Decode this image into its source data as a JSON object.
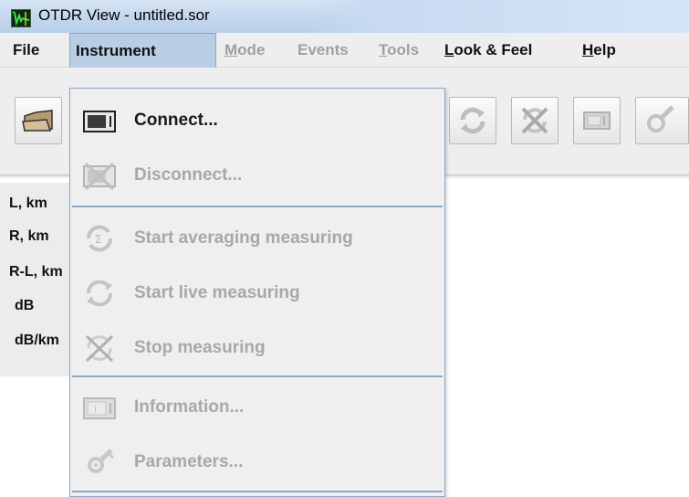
{
  "window": {
    "title": "OTDR View - untitled.sor",
    "icon": "otdr-app-icon"
  },
  "menubar": {
    "file": "File",
    "instrument": "Instrument",
    "mode": "Mode",
    "events": "Events",
    "tools": "Tools",
    "look_feel": "Look & Feel",
    "help": "Help",
    "active_menu": "Instrument"
  },
  "toolbar": {
    "buttons": [
      {
        "name": "open-folder",
        "icon": "folder-icon",
        "enabled": true
      },
      {
        "name": "start-live",
        "icon": "refresh-icon",
        "enabled": false
      },
      {
        "name": "stop",
        "icon": "stop-measure-icon",
        "enabled": false
      },
      {
        "name": "information",
        "icon": "instrument-info-icon",
        "enabled": false
      },
      {
        "name": "parameters",
        "icon": "wrench-gear-icon",
        "enabled": false
      }
    ]
  },
  "sidepanel": {
    "labels": [
      "L, km",
      "R, km",
      "R-L, km",
      "dB",
      "dB/km"
    ]
  },
  "dropdown": {
    "items": [
      {
        "label": "Connect...",
        "icon": "instrument-connect-icon",
        "enabled": true
      },
      {
        "label": "Disconnect...",
        "icon": "instrument-disconnect-icon",
        "enabled": false
      },
      {
        "label": "Start averaging measuring",
        "icon": "averaging-icon",
        "enabled": false
      },
      {
        "label": "Start live measuring",
        "icon": "refresh-icon",
        "enabled": false
      },
      {
        "label": "Stop measuring",
        "icon": "stop-measure-icon",
        "enabled": false
      },
      {
        "label": "Information...",
        "icon": "instrument-info-icon",
        "enabled": false
      },
      {
        "label": "Parameters...",
        "icon": "wrench-gear-icon",
        "enabled": false
      }
    ]
  },
  "colors": {
    "menu_highlight": "#b9cde4",
    "menu_border": "#8ca8c8",
    "disabled_text": "#a8a8a8",
    "panel_bg": "#eeeeee"
  }
}
